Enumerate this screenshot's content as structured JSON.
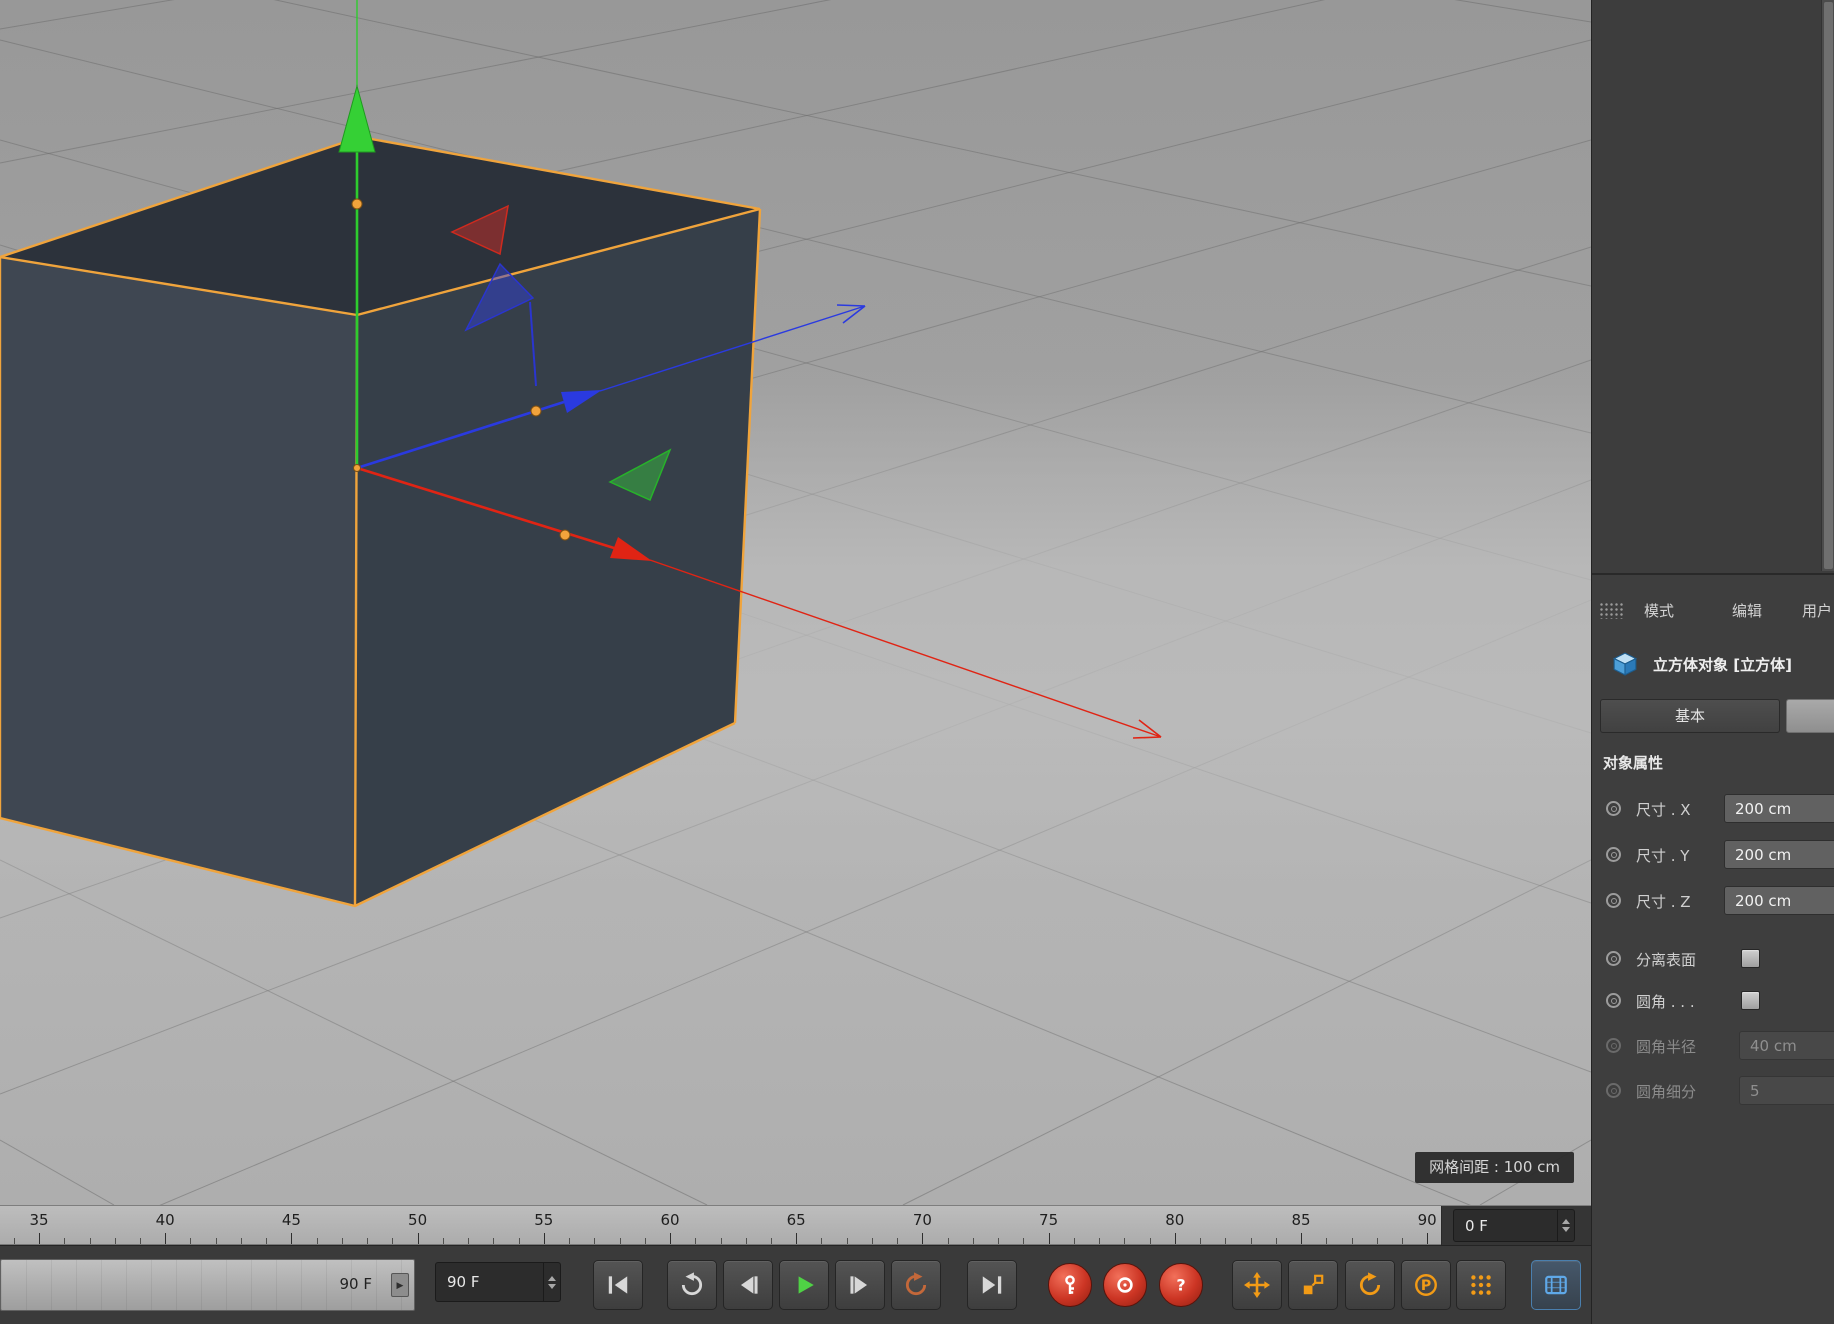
{
  "viewport": {
    "grid_spacing_label": "网格间距 : 100 cm"
  },
  "attributes_panel": {
    "menu_items": [
      "模式",
      "编辑",
      "用户"
    ],
    "object_title": "立方体对象 [立方体]",
    "tab_basic": "基本",
    "section_title": "对象属性",
    "size_fields": [
      {
        "label": "尺寸 . X",
        "value": "200 cm"
      },
      {
        "label": "尺寸 . Y",
        "value": "200 cm"
      },
      {
        "label": "尺寸 . Z",
        "value": "200 cm"
      }
    ],
    "toggle_fields": [
      {
        "label": "分离表面",
        "checked": false
      },
      {
        "label": "圆角 . . .",
        "checked": false
      }
    ],
    "disabled_fields": [
      {
        "label": "圆角半径",
        "value": "40 cm"
      },
      {
        "label": "圆角细分",
        "value": "5"
      }
    ]
  },
  "timeline": {
    "ruler_labels": [
      "35",
      "40",
      "45",
      "50",
      "55",
      "60",
      "65",
      "70",
      "75",
      "80",
      "85",
      "90"
    ],
    "current_frame_value": "0 F",
    "range_slider_label": "90 F",
    "frame_field_value": "90 F"
  },
  "toolbar_icons": [
    "goto-start",
    "play-reverse",
    "prev-frame",
    "play",
    "next-frame",
    "loop",
    "goto-end",
    "record-keyframe",
    "autokey",
    "record-help",
    "animate-position",
    "animate-scale",
    "animate-rotation",
    "animate-parameters",
    "animate-pla",
    "timeline-window"
  ],
  "colors": {
    "selection_orange": "#f0a43c",
    "axis_x_red": "#e02414",
    "axis_y_green": "#2ecc2e",
    "axis_z_blue": "#2a3ae0",
    "toolbar_accent_orange": "#f29b16",
    "record_red": "#cc3524",
    "film_blue": "#5fa8e8"
  }
}
